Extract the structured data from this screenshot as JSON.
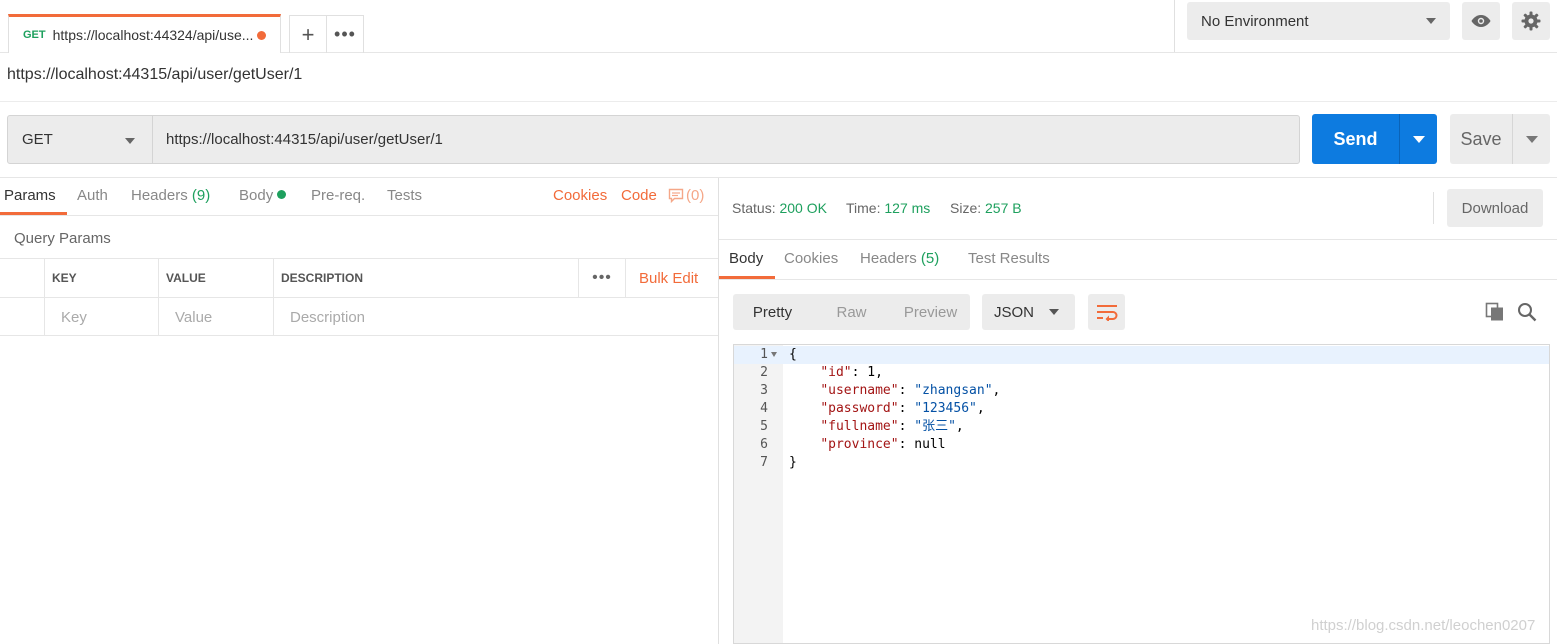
{
  "tab": {
    "method": "GET",
    "title": "https://localhost:44324/api/use..."
  },
  "tab_actions": {
    "add": "+",
    "more": "•••"
  },
  "environment": {
    "selected": "No Environment"
  },
  "request": {
    "name": "https://localhost:44315/api/user/getUser/1",
    "method": "GET",
    "url": "https://localhost:44315/api/user/getUser/1",
    "send_label": "Send",
    "save_label": "Save"
  },
  "request_tabs": {
    "params": "Params",
    "auth": "Auth",
    "headers": "Headers",
    "headers_count": "(9)",
    "body": "Body",
    "prereq": "Pre-req.",
    "tests": "Tests",
    "cookies": "Cookies",
    "code": "Code",
    "comments_count": "(0)"
  },
  "query_params": {
    "label": "Query Params",
    "columns": [
      "KEY",
      "VALUE",
      "DESCRIPTION"
    ],
    "more": "•••",
    "bulk_edit": "Bulk Edit",
    "placeholders": [
      "Key",
      "Value",
      "Description"
    ]
  },
  "response": {
    "status_label": "Status:",
    "status_value": "200 OK",
    "time_label": "Time:",
    "time_value": "127 ms",
    "size_label": "Size:",
    "size_value": "257 B",
    "download": "Download",
    "tabs": {
      "body": "Body",
      "cookies": "Cookies",
      "headers": "Headers",
      "headers_count": "(5)",
      "tests": "Test Results"
    },
    "views": [
      "Pretty",
      "Raw",
      "Preview"
    ],
    "format": "JSON",
    "code_lines": [
      {
        "n": "1",
        "text": "{"
      },
      {
        "n": "2",
        "key": "\"id\"",
        "sep": ": ",
        "val": "1",
        "end": ","
      },
      {
        "n": "3",
        "key": "\"username\"",
        "sep": ": ",
        "val": "\"zhangsan\"",
        "end": ","
      },
      {
        "n": "4",
        "key": "\"password\"",
        "sep": ": ",
        "val": "\"123456\"",
        "end": ","
      },
      {
        "n": "5",
        "key": "\"fullname\"",
        "sep": ": ",
        "val": "\"张三\"",
        "end": ","
      },
      {
        "n": "6",
        "key": "\"province\"",
        "sep": ": ",
        "val": "null",
        "end": ""
      },
      {
        "n": "7",
        "text": "}"
      }
    ]
  },
  "watermark": "https://blog.csdn.net/leochen0207",
  "colors": {
    "accent": "#f26b3a",
    "send": "#0d7be0",
    "success": "#1ea05e"
  }
}
